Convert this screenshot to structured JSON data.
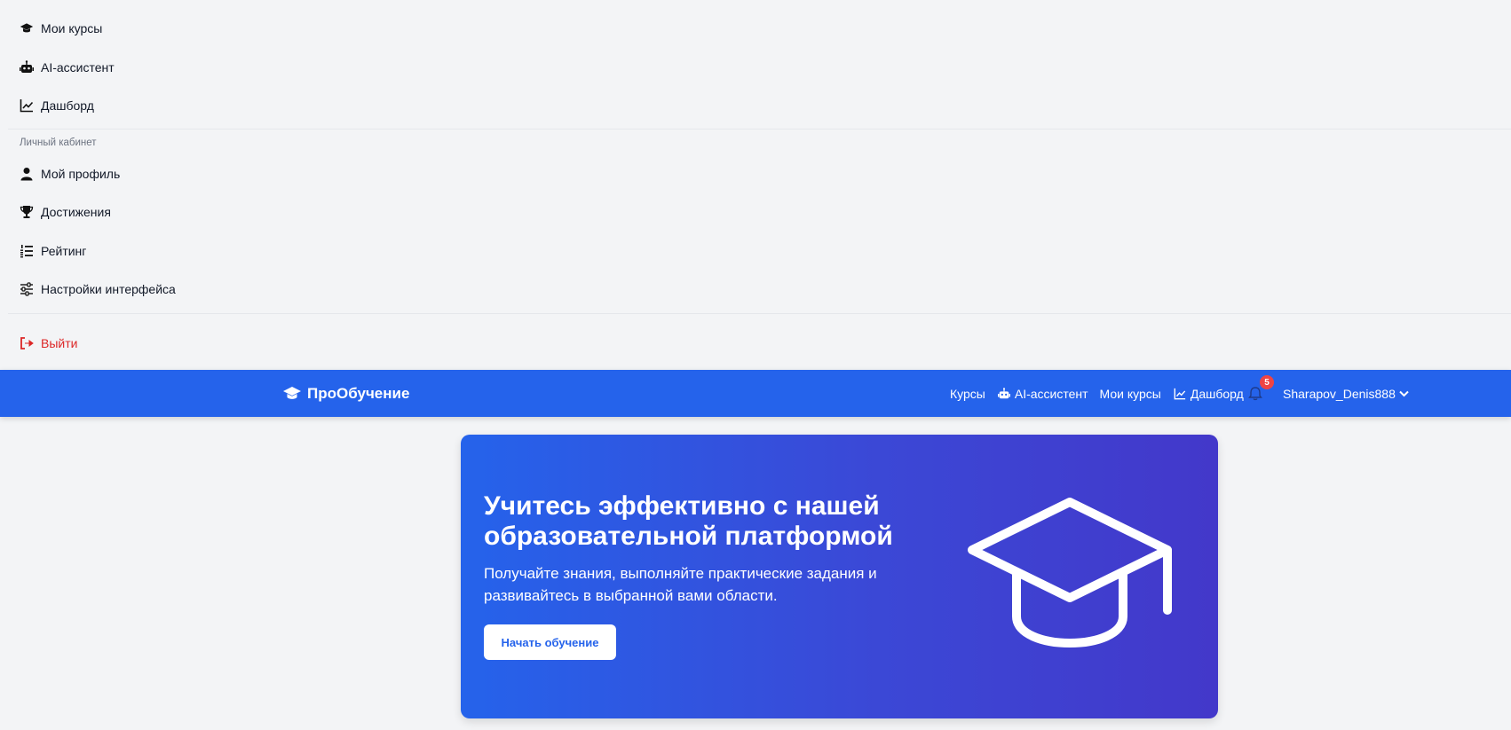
{
  "menu": {
    "items": [
      {
        "label": "Мои курсы",
        "icon": "graduation-cap-icon"
      },
      {
        "label": "AI-ассистент",
        "icon": "robot-icon"
      },
      {
        "label": "Дашборд",
        "icon": "chart-line-icon"
      }
    ],
    "section_label": "Личный кабинет",
    "profile_items": [
      {
        "label": "Мой профиль",
        "icon": "user-icon"
      },
      {
        "label": "Достижения",
        "icon": "trophy-icon"
      },
      {
        "label": "Рейтинг",
        "icon": "list-ol-icon"
      },
      {
        "label": "Настройки интерфейса",
        "icon": "sliders-icon"
      }
    ],
    "logout_label": "Выйти"
  },
  "navbar": {
    "brand": "ПроОбучение",
    "links": [
      {
        "label": "Курсы"
      },
      {
        "label": "AI-ассистент",
        "icon": "robot-icon"
      },
      {
        "label": "Мои курсы"
      },
      {
        "label": "Дашборд",
        "icon": "chart-line-icon"
      }
    ],
    "notification_count": "5",
    "username": "Sharapov_Denis888"
  },
  "hero": {
    "title": "Учитесь эффективно с нашей образовательной платформой",
    "subtitle": "Получайте знания, выполняйте практические задания и развивайтесь в выбранной вами области.",
    "button_label": "Начать обучение"
  },
  "colors": {
    "primary": "#2563eb",
    "hero_gradient_end": "#4338ca",
    "danger": "#dc2626",
    "badge": "#ef4444"
  }
}
